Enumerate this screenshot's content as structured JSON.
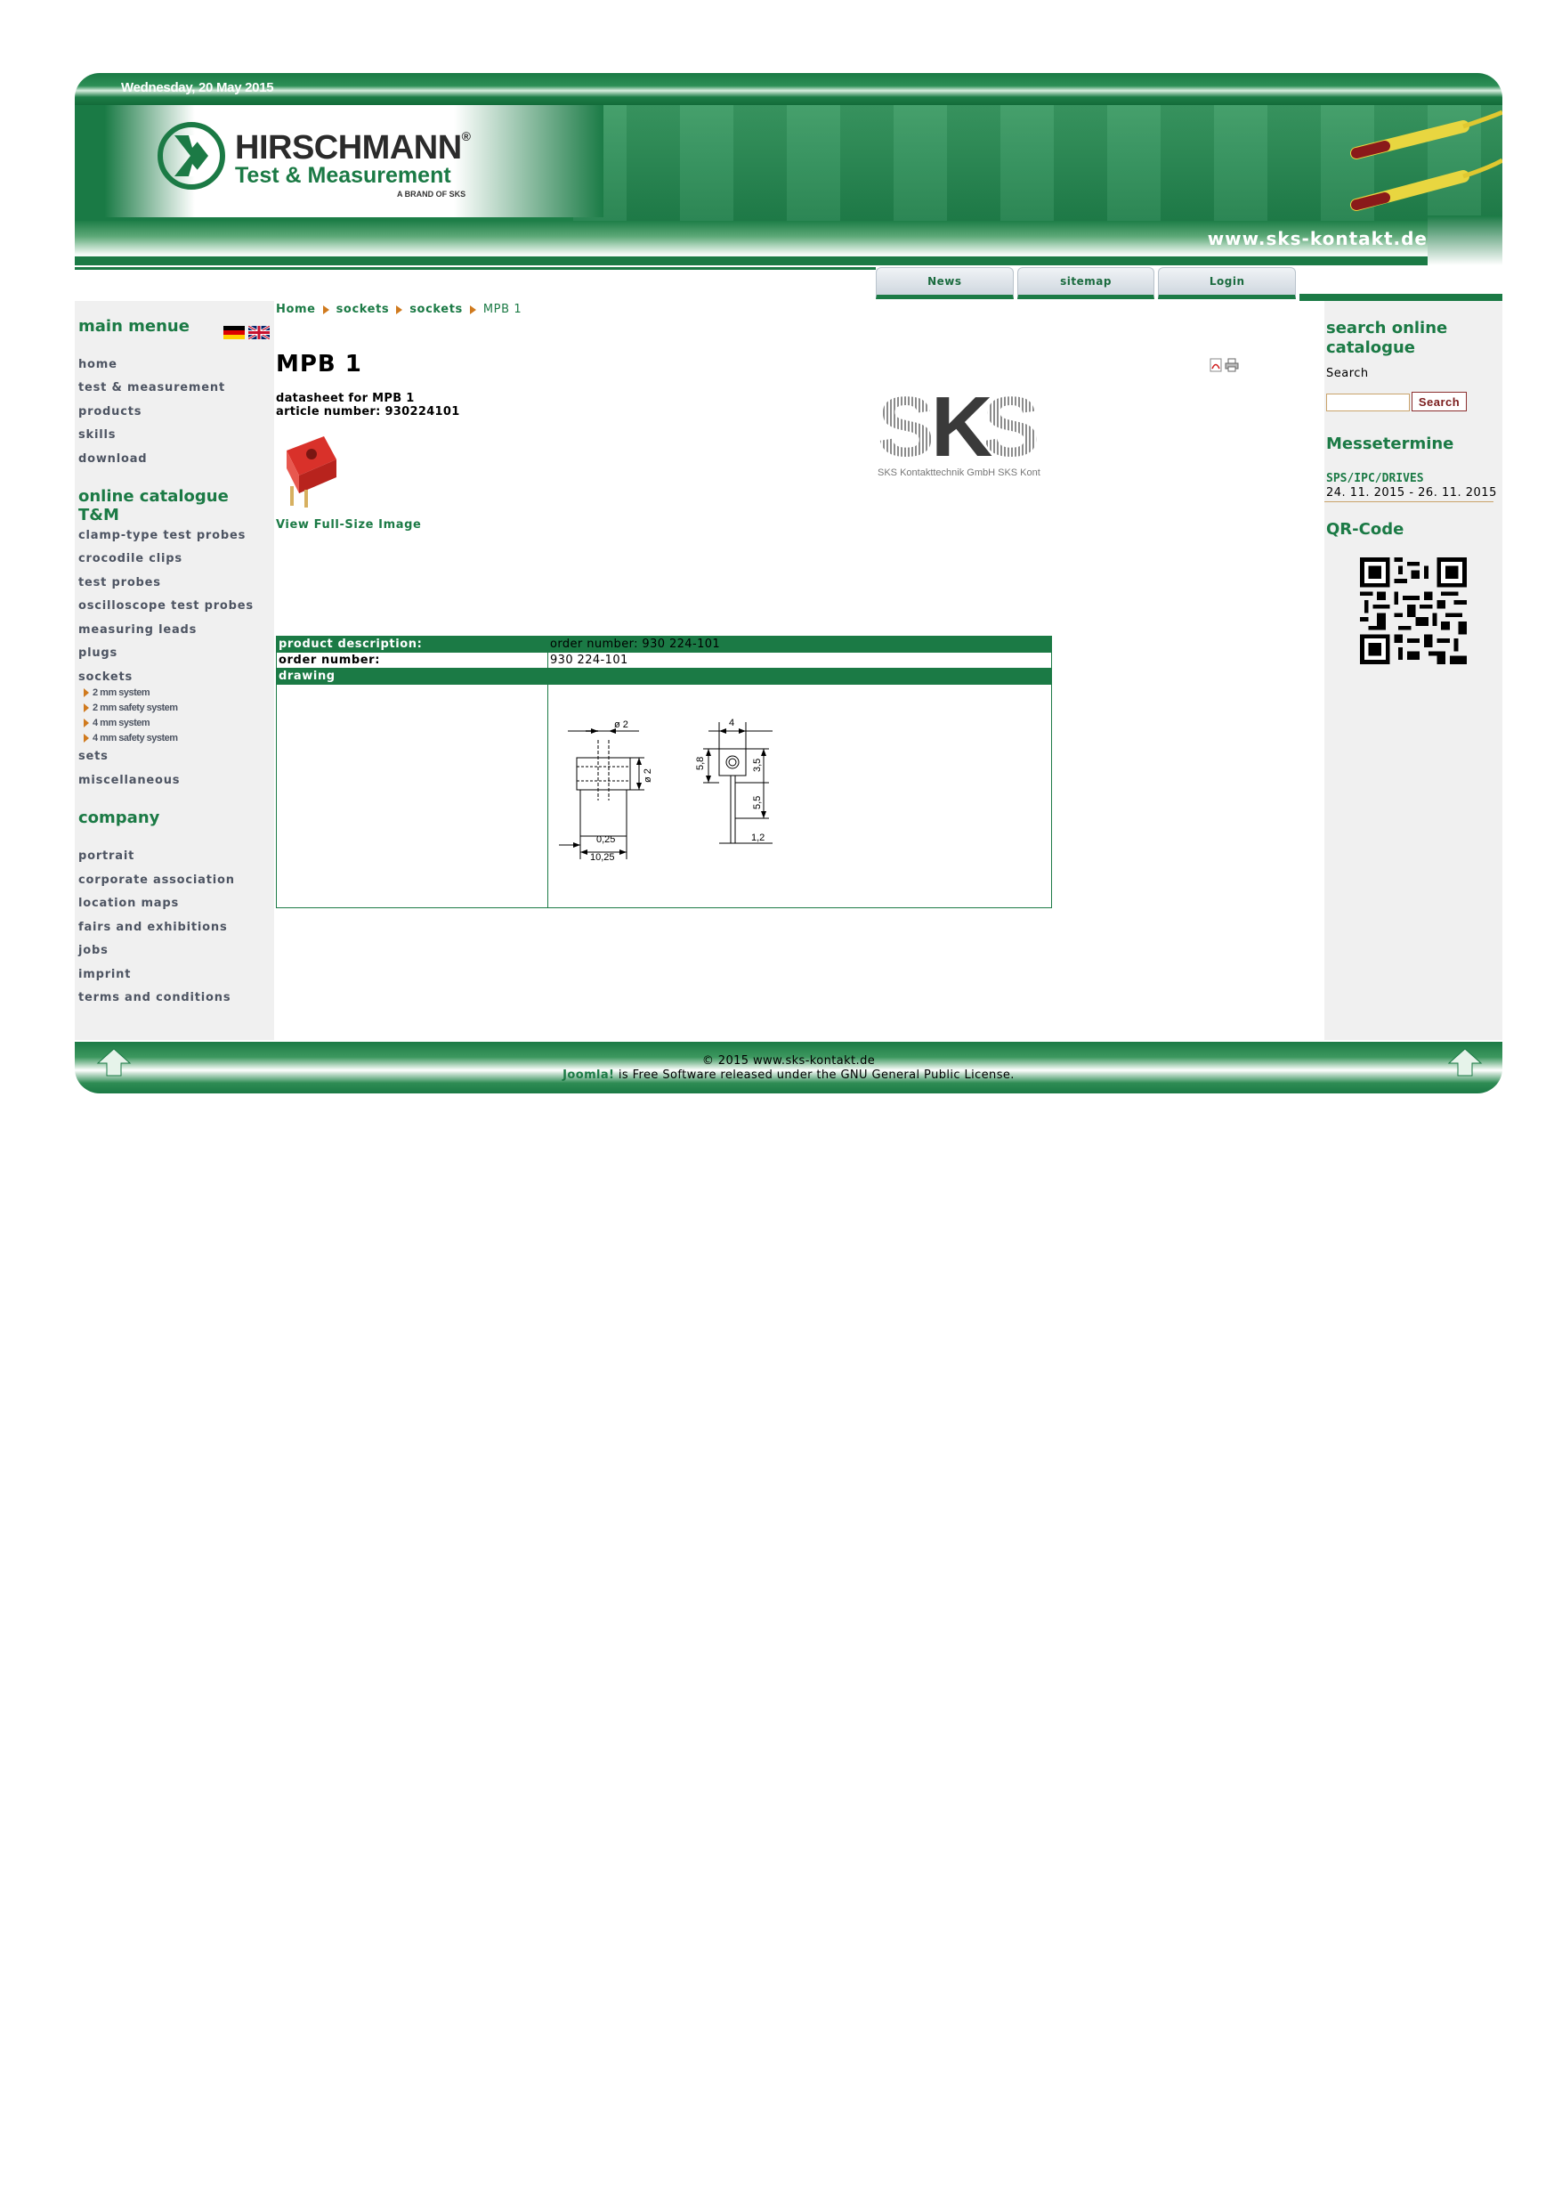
{
  "header": {
    "date": "Wednesday, 20 May 2015",
    "brand_name": "HIRSCHMANN",
    "brand_reg": "®",
    "brand_tagline": "Test & Measurement",
    "brand_sub": "A BRAND OF SKS",
    "url": "www.sks-kontakt.de"
  },
  "tabs": [
    "News",
    "sitemap",
    "Login"
  ],
  "left": {
    "main_title": "main menue",
    "main_items": [
      "home",
      "test & measurement",
      "products",
      "skills",
      "download"
    ],
    "catalogue_title": "online catalogue T&M",
    "catalogue_items": [
      "clamp-type test probes",
      "crocodile clips",
      "test probes",
      "oscilloscope test probes",
      "measuring leads",
      "plugs",
      "sockets"
    ],
    "socket_sub_items": [
      "2 mm system",
      "2 mm safety system",
      "4 mm system",
      "4 mm safety system"
    ],
    "catalogue_items_after": [
      "sets",
      "miscellaneous"
    ],
    "company_title": "company",
    "company_items": [
      "portrait",
      "corporate association",
      "location maps",
      "fairs and exhibitions",
      "jobs",
      "imprint",
      "terms and conditions"
    ]
  },
  "breadcrumb": [
    "Home",
    "sockets",
    "sockets",
    "MPB 1"
  ],
  "main": {
    "title": "MPB 1",
    "datasheet_line": "datasheet for MPB 1",
    "article_line": "article number: 930224101",
    "full_size_link": "View Full-Size Image",
    "sks_logo_text": "SKS Kontakttechnik GmbH SKS Kont"
  },
  "table": {
    "rows": [
      {
        "label": "product description:",
        "value": "order number: 930 224-101"
      },
      {
        "label": "order number:",
        "value": "930 224-101"
      }
    ],
    "drawing_header": "drawing",
    "drawing_dims": [
      "ø 2",
      "4",
      "5,8",
      "3,5",
      "ø 2",
      "5,5",
      "0,25",
      "10,25",
      "1,2"
    ]
  },
  "right": {
    "search_title": "search online catalogue",
    "search_label": "Search",
    "search_value": "",
    "search_button": "Search",
    "events_title": "Messetermine",
    "event_name": "SPS/IPC/DRIVES",
    "event_date": "24. 11. 2015 - 26. 11. 2015",
    "qr_title": "QR-Code"
  },
  "footer": {
    "copyright": "© 2015 www.sks-kontakt.de",
    "joomla": "Joomla!",
    "license": " is Free Software released under the GNU General Public License."
  },
  "colors": {
    "brand_green": "#1b7a45",
    "menu_text": "#4d5462",
    "arrow_orange": "#d07a1e",
    "sidebar_bg": "#f0f0f0"
  }
}
